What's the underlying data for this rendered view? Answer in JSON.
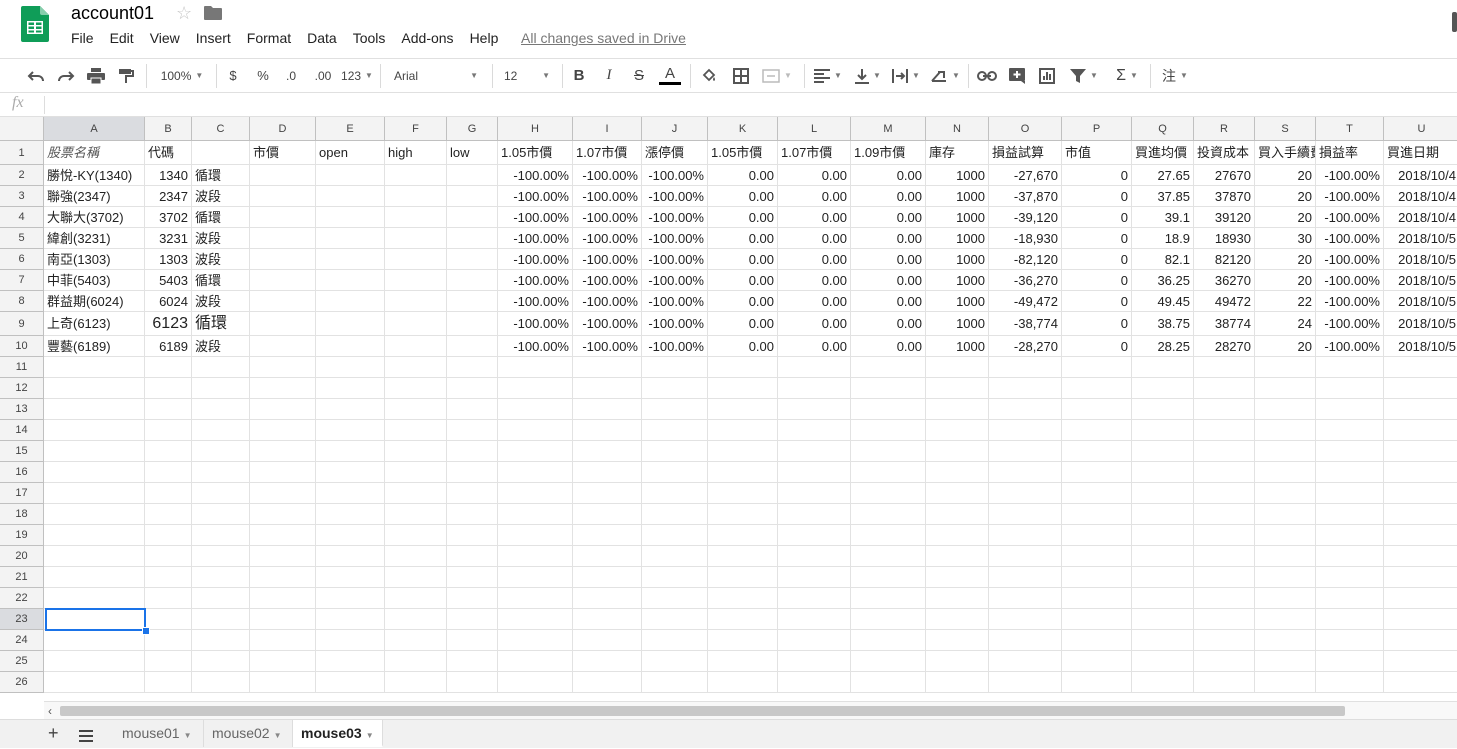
{
  "app": {
    "title": "account01",
    "saved_status": "All changes saved in Drive",
    "menu": [
      "File",
      "Edit",
      "View",
      "Insert",
      "Format",
      "Data",
      "Tools",
      "Add-ons",
      "Help"
    ]
  },
  "toolbar": {
    "zoom": "100%",
    "currency": "$",
    "percent": "%",
    "decimal_less": ".0",
    "decimal_more": ".00",
    "more_formats": "123",
    "font": "Arial",
    "font_size": "12",
    "bold": "B",
    "italic": "I",
    "strike": "S",
    "text_color": "A",
    "cjk": "注"
  },
  "formula_bar": {
    "fx": "fx",
    "value": ""
  },
  "columns": [
    "A",
    "B",
    "C",
    "D",
    "E",
    "F",
    "G",
    "H",
    "I",
    "J",
    "K",
    "L",
    "M",
    "N",
    "O",
    "P",
    "Q",
    "R",
    "S",
    "T",
    "U"
  ],
  "header_row": [
    "股票名稱",
    "代碼",
    "",
    "市價",
    "open",
    "high",
    "low",
    "1.05市價",
    "1.07市價",
    "漲停價",
    "1.05市價",
    "1.07市價",
    "1.09市價",
    "庫存",
    "損益試算",
    "市值",
    "買進均價",
    "投資成本",
    "買入手續費",
    "損益率",
    "買進日期"
  ],
  "rows": [
    [
      "勝悅-KY(1340)",
      "1340",
      "循環",
      "",
      "",
      "",
      "",
      "-100.00%",
      "-100.00%",
      "-100.00%",
      "0.00",
      "0.00",
      "0.00",
      "1000",
      "-27,670",
      "0",
      "27.65",
      "27670",
      "20",
      "-100.00%",
      "2018/10/4"
    ],
    [
      "聯強(2347)",
      "2347",
      "波段",
      "",
      "",
      "",
      "",
      "-100.00%",
      "-100.00%",
      "-100.00%",
      "0.00",
      "0.00",
      "0.00",
      "1000",
      "-37,870",
      "0",
      "37.85",
      "37870",
      "20",
      "-100.00%",
      "2018/10/4"
    ],
    [
      "大聯大(3702)",
      "3702",
      "循環",
      "",
      "",
      "",
      "",
      "-100.00%",
      "-100.00%",
      "-100.00%",
      "0.00",
      "0.00",
      "0.00",
      "1000",
      "-39,120",
      "0",
      "39.1",
      "39120",
      "20",
      "-100.00%",
      "2018/10/4"
    ],
    [
      "緯創(3231)",
      "3231",
      "波段",
      "",
      "",
      "",
      "",
      "-100.00%",
      "-100.00%",
      "-100.00%",
      "0.00",
      "0.00",
      "0.00",
      "1000",
      "-18,930",
      "0",
      "18.9",
      "18930",
      "30",
      "-100.00%",
      "2018/10/5"
    ],
    [
      "南亞(1303)",
      "1303",
      "波段",
      "",
      "",
      "",
      "",
      "-100.00%",
      "-100.00%",
      "-100.00%",
      "0.00",
      "0.00",
      "0.00",
      "1000",
      "-82,120",
      "0",
      "82.1",
      "82120",
      "20",
      "-100.00%",
      "2018/10/5"
    ],
    [
      "中菲(5403)",
      "5403",
      "循環",
      "",
      "",
      "",
      "",
      "-100.00%",
      "-100.00%",
      "-100.00%",
      "0.00",
      "0.00",
      "0.00",
      "1000",
      "-36,270",
      "0",
      "36.25",
      "36270",
      "20",
      "-100.00%",
      "2018/10/5"
    ],
    [
      "群益期(6024)",
      "6024",
      "波段",
      "",
      "",
      "",
      "",
      "-100.00%",
      "-100.00%",
      "-100.00%",
      "0.00",
      "0.00",
      "0.00",
      "1000",
      "-49,472",
      "0",
      "49.45",
      "49472",
      "22",
      "-100.00%",
      "2018/10/5"
    ],
    [
      "上奇(6123)",
      "6123",
      "循環",
      "",
      "",
      "",
      "",
      "-100.00%",
      "-100.00%",
      "-100.00%",
      "0.00",
      "0.00",
      "0.00",
      "1000",
      "-38,774",
      "0",
      "38.75",
      "38774",
      "24",
      "-100.00%",
      "2018/10/5"
    ],
    [
      "豐藝(6189)",
      "6189",
      "波段",
      "",
      "",
      "",
      "",
      "-100.00%",
      "-100.00%",
      "-100.00%",
      "0.00",
      "0.00",
      "0.00",
      "1000",
      "-28,270",
      "0",
      "28.25",
      "28270",
      "20",
      "-100.00%",
      "2018/10/5"
    ]
  ],
  "row_numbers": [
    "1",
    "2",
    "3",
    "4",
    "5",
    "6",
    "7",
    "8",
    "9",
    "10",
    "11",
    "12",
    "13",
    "14",
    "15",
    "16",
    "17",
    "18",
    "19",
    "20",
    "21",
    "22",
    "23",
    "24",
    "25",
    "26"
  ],
  "selected_cell": "A23",
  "sheets": [
    {
      "name": "mouse01",
      "active": false
    },
    {
      "name": "mouse02",
      "active": false
    },
    {
      "name": "mouse03",
      "active": true
    }
  ],
  "colors": {
    "accent": "#1a73e8",
    "sheets_green": "#0f9d58"
  }
}
